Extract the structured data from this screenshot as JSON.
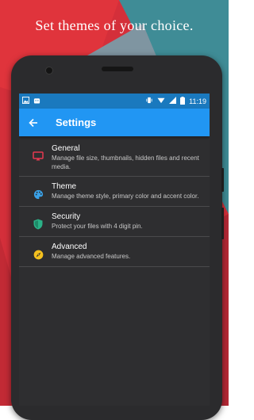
{
  "headline": "Set themes of your choice.",
  "colors": {
    "bg_red": "#e0303a",
    "bg_teal": "#3f8c96",
    "bg_grey": "#7f95a1",
    "status_bar": "#1a79be",
    "app_bar": "#2196f3",
    "screen_bg": "#2e2e30"
  },
  "status": {
    "time": "11:19"
  },
  "appbar": {
    "title": "Settings"
  },
  "settings": [
    {
      "title": "General",
      "desc": "Manage file size, thumbnails, hidden files and recent media.",
      "icon": "cast-icon",
      "color": "#e53950"
    },
    {
      "title": "Theme",
      "desc": "Manage theme style, primary color and accent color.",
      "icon": "palette-icon",
      "color": "#3aa2e8"
    },
    {
      "title": "Security",
      "desc": "Protect your files with 4 digit pin.",
      "icon": "shield-icon",
      "color": "#2bb187"
    },
    {
      "title": "Advanced",
      "desc": "Manage advanced features.",
      "icon": "compass-icon",
      "color": "#f4c01e"
    }
  ]
}
